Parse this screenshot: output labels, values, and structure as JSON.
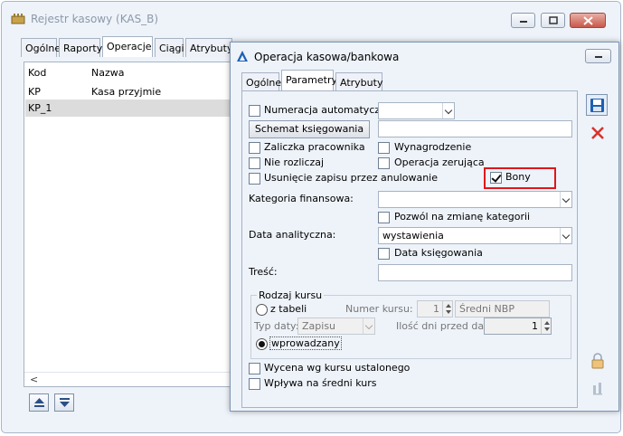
{
  "bg_window": {
    "title": "Rejestr kasowy (KAS_B)",
    "tabs": [
      "Ogólne",
      "Raporty",
      "Operacje",
      "Ciągi",
      "Atrybuty"
    ],
    "active_tab": "Operacje",
    "columns": [
      "Kod",
      "Nazwa"
    ],
    "rows": [
      {
        "kod": "KP",
        "nazwa": "Kasa przyjmie"
      },
      {
        "kod": "KP_1",
        "nazwa": ""
      }
    ],
    "scroll_left": "<"
  },
  "dialog": {
    "title": "Operacja kasowa/bankowa",
    "tabs": [
      "Ogólne",
      "Parametry",
      "Atrybuty"
    ],
    "active_tab": "Parametry",
    "numeracja_label": "Numeracja automatyczna",
    "numeracja_value": "",
    "schemat_button": "Schemat księgowania",
    "schemat_value": "",
    "zaliczka_label": "Zaliczka pracownika",
    "wynagrodzenie_label": "Wynagrodzenie",
    "nie_rozliczaj_label": "Nie rozliczaj",
    "operacja_zerujaca_label": "Operacja zerująca",
    "usuniecie_label": "Usunięcie zapisu przez anulowanie",
    "bony_label": "Bony",
    "bony_checked": true,
    "kategoria_label": "Kategoria finansowa:",
    "kategoria_value": "",
    "pozwol_label": "Pozwól na zmianę kategorii",
    "data_analityczna_label": "Data analityczna:",
    "data_analityczna_value": "wystawienia",
    "data_ksiegowania_label": "Data księgowania",
    "tresc_label": "Treść:",
    "tresc_value": "",
    "rodzaj_kursu_legend": "Rodzaj kursu",
    "z_tabeli_label": "z tabeli",
    "numer_kursu_label": "Numer kursu:",
    "numer_kursu_value": "1",
    "sredni_nbp": "Średni NBP",
    "typ_daty_label": "Typ daty:",
    "typ_daty_value": "Zapisu",
    "ilosc_dni_label": "Ilość dni przed datą:",
    "ilosc_dni_value": "1",
    "wprowadzany_label": "wprowadzany",
    "wycena_label": "Wycena wg kursu ustalonego",
    "wplywa_label": "Wpływa na średni kurs",
    "highlight_color": "#e0161b",
    "accent_color": "#1e5fb4"
  }
}
